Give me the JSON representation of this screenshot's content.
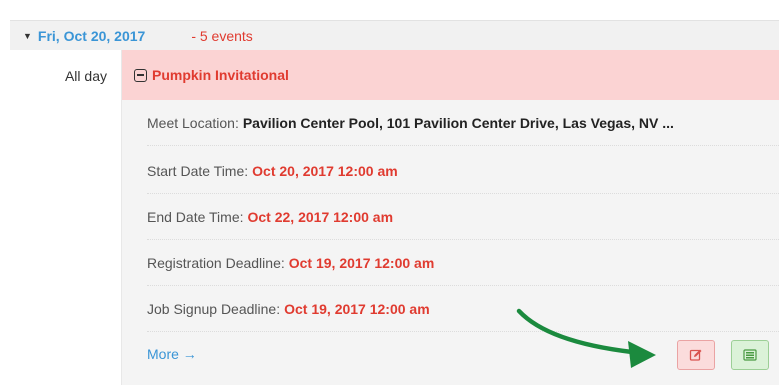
{
  "day": {
    "date": "Fri, Oct 20, 2017",
    "count": "- 5 events"
  },
  "allday_label": "All day",
  "event": {
    "title": "Pumpkin Invitational",
    "location": {
      "label": "Meet Location:",
      "value": "Pavilion Center Pool, 101 Pavilion Center Drive, Las Vegas, NV ..."
    },
    "start": {
      "label": "Start Date Time:",
      "value": "Oct 20, 2017 12:00 am"
    },
    "end": {
      "label": "End Date Time:",
      "value": "Oct 22, 2017 12:00 am"
    },
    "registration": {
      "label": "Registration Deadline:",
      "value": "Oct 19, 2017 12:00 am"
    },
    "job_signup": {
      "label": "Job Signup Deadline:",
      "value": "Oct 19, 2017 12:00 am"
    },
    "more_label": "More →"
  },
  "icons": {
    "caret": "caret-down-icon",
    "collapse": "minus-square-icon",
    "edit": "edit-icon",
    "view": "list-icon",
    "annotation": "green-arrow"
  },
  "colors": {
    "accent_blue": "#3a95d6",
    "accent_red": "#e03b30",
    "title_bg": "#fbd3d3",
    "annotation_green": "#1b8a3e"
  }
}
